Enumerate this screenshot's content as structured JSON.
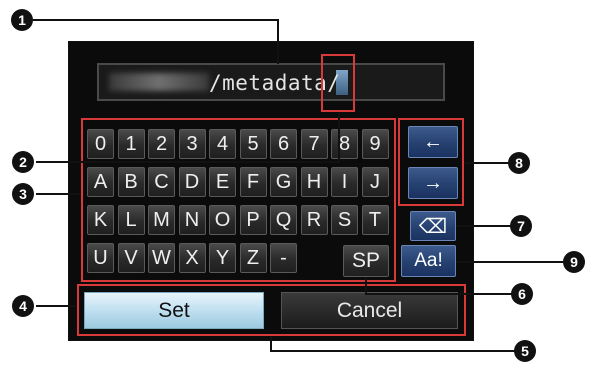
{
  "text_field": {
    "value": "/metadata/"
  },
  "keyboard": {
    "rows": [
      [
        "0",
        "1",
        "2",
        "3",
        "4",
        "5",
        "6",
        "7",
        "8",
        "9"
      ],
      [
        "A",
        "B",
        "C",
        "D",
        "E",
        "F",
        "G",
        "H",
        "I",
        "J"
      ],
      [
        "K",
        "L",
        "M",
        "N",
        "O",
        "P",
        "Q",
        "R",
        "S",
        "T"
      ],
      [
        "U",
        "V",
        "W",
        "X",
        "Y",
        "Z",
        "-"
      ]
    ],
    "arrow_left": "←",
    "arrow_right": "→",
    "backspace": "⌫",
    "space": "SP",
    "case_toggle": "Aa!"
  },
  "buttons": {
    "set": "Set",
    "cancel": "Cancel"
  },
  "callouts": [
    "1",
    "2",
    "3",
    "4",
    "5",
    "6",
    "7",
    "8",
    "9"
  ],
  "colors": {
    "highlight": "#d83a3a",
    "set_button": "#bfe0f0",
    "screen_bg": "#0b0b0b"
  }
}
